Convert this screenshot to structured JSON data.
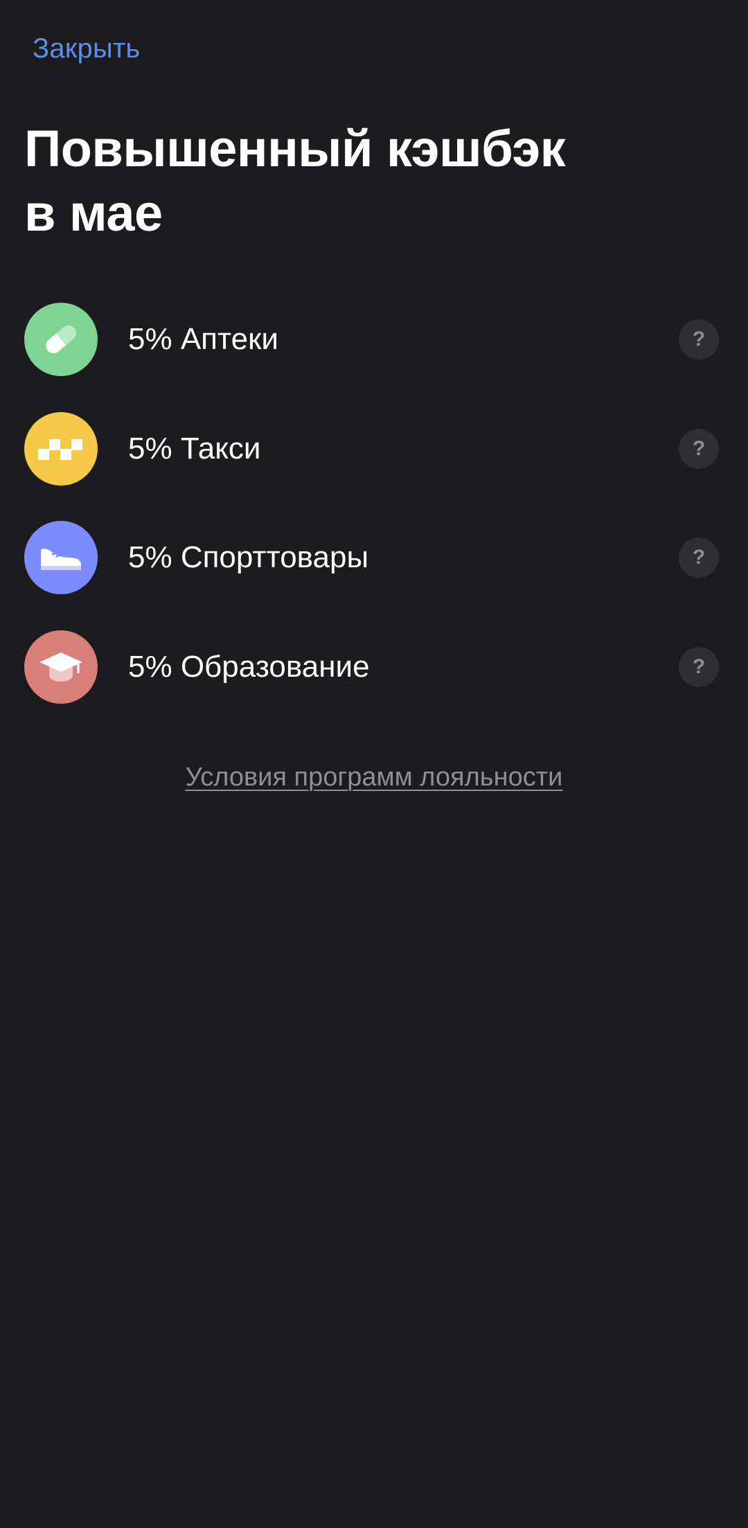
{
  "header": {
    "close_label": "Закрыть"
  },
  "title": "Повышенный кэшбэк\nв мае",
  "categories": [
    {
      "label": "5% Аптеки",
      "icon": "pill-icon",
      "color": "#7ed492",
      "help": "?"
    },
    {
      "label": "5% Такси",
      "icon": "taxi-checker-icon",
      "color": "#f7c948",
      "help": "?"
    },
    {
      "label": "5% Спорттовары",
      "icon": "sneaker-icon",
      "color": "#7b8cff",
      "help": "?"
    },
    {
      "label": "5% Образование",
      "icon": "graduation-cap-icon",
      "color": "#d97f79",
      "help": "?"
    }
  ],
  "footer": {
    "terms_label": "Условия программ лояльности"
  },
  "colors": {
    "background": "#1c1c1e",
    "accent": "#5b8def",
    "muted": "#8e8e93"
  }
}
